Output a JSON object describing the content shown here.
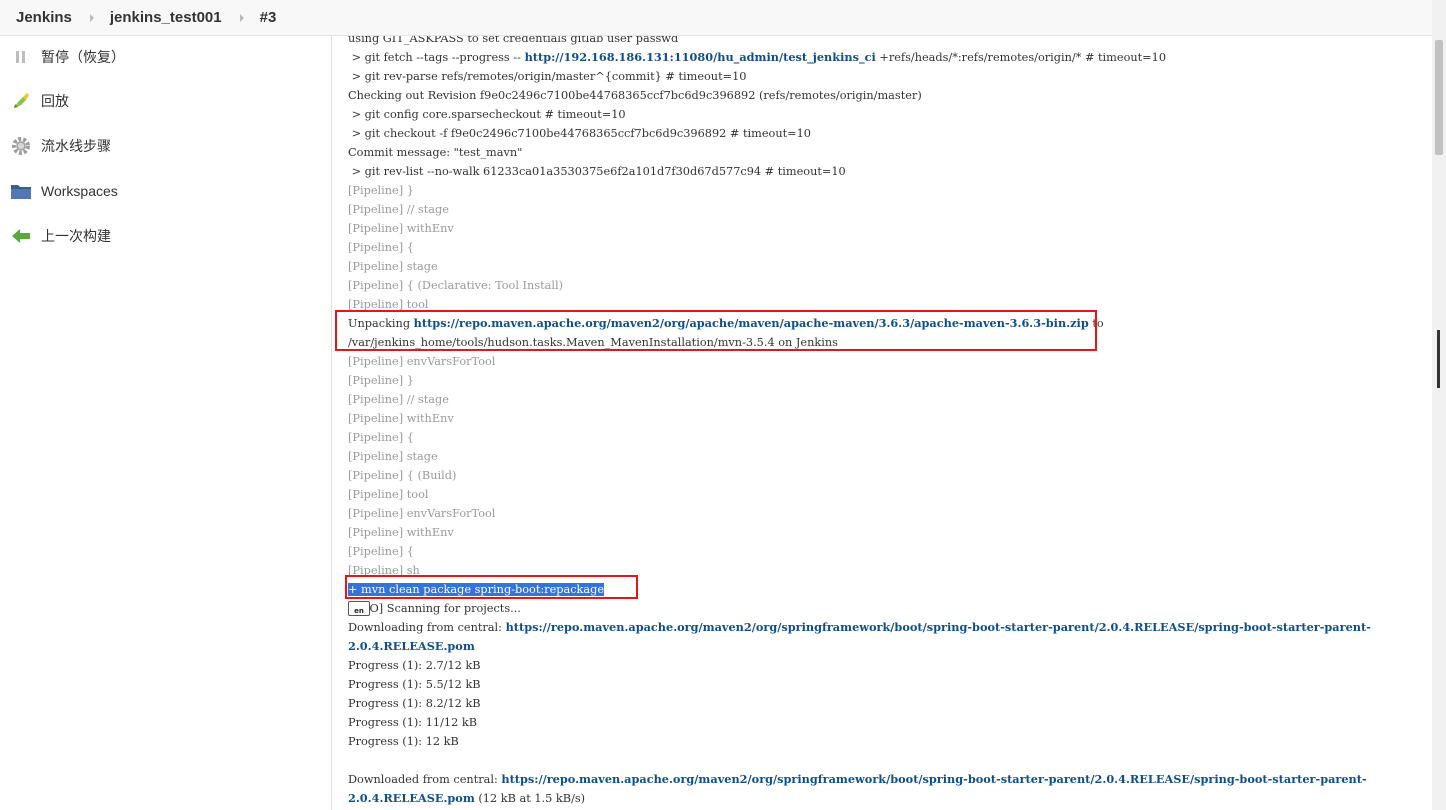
{
  "breadcrumb": {
    "items": [
      "Jenkins",
      "jenkins_test001",
      "#3"
    ]
  },
  "sidebar": {
    "items": [
      {
        "label": "暂停（恢复）",
        "icon": "pause-icon"
      },
      {
        "label": "回放",
        "icon": "replay-icon"
      },
      {
        "label": "流水线步骤",
        "icon": "gear-icon"
      },
      {
        "label": "Workspaces",
        "icon": "folder-icon"
      },
      {
        "label": "上一次构建",
        "icon": "arrow-left-icon"
      }
    ]
  },
  "console": {
    "lines": [
      {
        "text": "using GIT_ASKPASS to set credentials gitlab user passwd",
        "style": "normal"
      },
      {
        "parts": [
          {
            "t": " > git fetch --tags --progress -- "
          },
          {
            "t": "http://192.168.186.131:11080/hu_admin/test_jenkins_ci",
            "link": true
          },
          {
            "t": " +refs/heads/*:refs/remotes/origin/* # timeout=10"
          }
        ],
        "style": "normal"
      },
      {
        "text": " > git rev-parse refs/remotes/origin/master^{commit} # timeout=10",
        "style": "normal"
      },
      {
        "text": "Checking out Revision f9e0c2496c7100be44768365ccf7bc6d9c396892 (refs/remotes/origin/master)",
        "style": "normal"
      },
      {
        "text": " > git config core.sparsecheckout # timeout=10",
        "style": "normal"
      },
      {
        "text": " > git checkout -f f9e0c2496c7100be44768365ccf7bc6d9c396892 # timeout=10",
        "style": "normal"
      },
      {
        "text": "Commit message: \"test_mavn\"",
        "style": "normal"
      },
      {
        "text": " > git rev-list --no-walk 61233ca01a3530375e6f2a101d7f30d67d577c94 # timeout=10",
        "style": "normal"
      },
      {
        "text": "[Pipeline] }",
        "style": "pipe"
      },
      {
        "text": "[Pipeline] // stage",
        "style": "pipe"
      },
      {
        "text": "[Pipeline] withEnv",
        "style": "pipe"
      },
      {
        "text": "[Pipeline] {",
        "style": "pipe"
      },
      {
        "text": "[Pipeline] stage",
        "style": "pipe"
      },
      {
        "text": "[Pipeline] { (Declarative: Tool Install)",
        "style": "pipe"
      },
      {
        "text": "[Pipeline] tool",
        "style": "pipe"
      },
      {
        "parts": [
          {
            "t": "Unpacking "
          },
          {
            "t": "https://repo.maven.apache.org/maven2/org/apache/maven/apache-maven/3.6.3/apache-maven-3.6.3-bin.zip",
            "link": true
          },
          {
            "t": " to"
          }
        ],
        "style": "normal"
      },
      {
        "text": "/var/jenkins_home/tools/hudson.tasks.Maven_MavenInstallation/mvn-3.5.4 on Jenkins",
        "style": "normal"
      },
      {
        "text": "[Pipeline] envVarsForTool",
        "style": "pipe"
      },
      {
        "text": "[Pipeline] }",
        "style": "pipe"
      },
      {
        "text": "[Pipeline] // stage",
        "style": "pipe"
      },
      {
        "text": "[Pipeline] withEnv",
        "style": "pipe"
      },
      {
        "text": "[Pipeline] {",
        "style": "pipe"
      },
      {
        "text": "[Pipeline] stage",
        "style": "pipe"
      },
      {
        "text": "[Pipeline] { (Build)",
        "style": "pipe"
      },
      {
        "text": "[Pipeline] tool",
        "style": "pipe"
      },
      {
        "text": "[Pipeline] envVarsForTool",
        "style": "pipe"
      },
      {
        "text": "[Pipeline] withEnv",
        "style": "pipe"
      },
      {
        "text": "[Pipeline] {",
        "style": "pipe"
      },
      {
        "text": "[Pipeline] sh",
        "style": "pipe"
      },
      {
        "text": "+ mvn clean package spring-boot:repackage",
        "style": "sel"
      },
      {
        "text": "      O] Scanning for projects...",
        "style": "ime"
      },
      {
        "parts": [
          {
            "t": "Downloading from central: "
          },
          {
            "t": "https://repo.maven.apache.org/maven2/org/springframework/boot/spring-boot-starter-parent/2.0.4.RELEASE/spring-boot-starter-parent-",
            "link": true
          }
        ],
        "style": "normal"
      },
      {
        "parts": [
          {
            "t": "2.0.4.RELEASE.pom",
            "link": true
          }
        ],
        "style": "normal"
      },
      {
        "text": "Progress (1): 2.7/12 kB",
        "style": "normal"
      },
      {
        "text": "Progress (1): 5.5/12 kB",
        "style": "normal"
      },
      {
        "text": "Progress (1): 8.2/12 kB",
        "style": "normal"
      },
      {
        "text": "Progress (1): 11/12 kB",
        "style": "normal"
      },
      {
        "text": "Progress (1): 12 kB",
        "style": "normal"
      },
      {
        "text": "",
        "style": "normal"
      },
      {
        "parts": [
          {
            "t": "Downloaded from central: "
          },
          {
            "t": "https://repo.maven.apache.org/maven2/org/springframework/boot/spring-boot-starter-parent/2.0.4.RELEASE/spring-boot-starter-parent-",
            "link": true
          }
        ],
        "style": "normal"
      },
      {
        "parts": [
          {
            "t": "2.0.4.RELEASE.pom",
            "link": true
          },
          {
            "t": " (12 kB at 1.5 kB/s)"
          }
        ],
        "style": "normal"
      }
    ]
  },
  "colors": {
    "link": "#104e8b",
    "pipeline": "#9a9a9a",
    "highlight_box": "#e8141a",
    "selection": "#3374d8"
  }
}
